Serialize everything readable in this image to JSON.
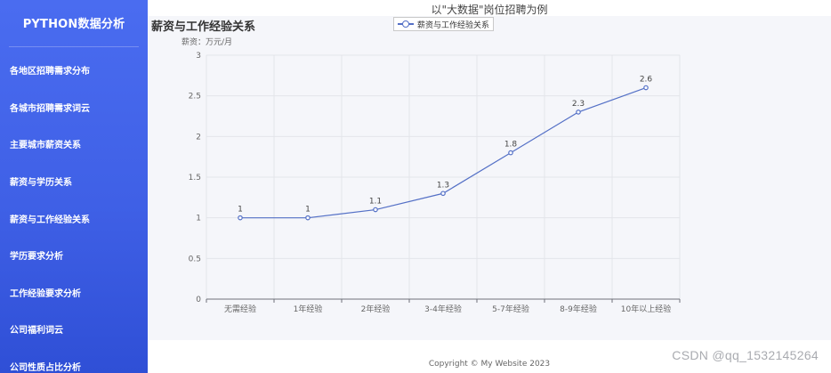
{
  "sidebar": {
    "brand": "PYTHON数据分析",
    "items": [
      {
        "label": "各地区招聘需求分布"
      },
      {
        "label": "各城市招聘需求词云"
      },
      {
        "label": "主要城市薪资关系"
      },
      {
        "label": "薪资与学历关系"
      },
      {
        "label": "薪资与工作经验关系"
      },
      {
        "label": "学历要求分析"
      },
      {
        "label": "工作经验要求分析"
      },
      {
        "label": "公司福利词云"
      },
      {
        "label": "公司性质占比分析"
      }
    ]
  },
  "top_note": "以\"大数据\"岗位招聘为例",
  "chart_data": {
    "type": "line",
    "title": "薪资与工作经验关系",
    "ylabel": "薪资：万元/月",
    "xlabel": "",
    "categories": [
      "无需经验",
      "1年经验",
      "2年经验",
      "3-4年经验",
      "5-7年经验",
      "8-9年经验",
      "10年以上经验"
    ],
    "series": [
      {
        "name": "薪资与工作经验关系",
        "values": [
          1,
          1,
          1.1,
          1.3,
          1.8,
          2.3,
          2.6
        ],
        "color": "#5470c6"
      }
    ],
    "ylim": [
      0,
      3
    ],
    "yticks": [
      "0",
      "0.5",
      "1",
      "1.5",
      "2",
      "2.5",
      "3"
    ],
    "grid": true,
    "legend": "top-center"
  },
  "footer": "Copyright © My Website 2023",
  "watermark": "CSDN @qq_1532145264"
}
